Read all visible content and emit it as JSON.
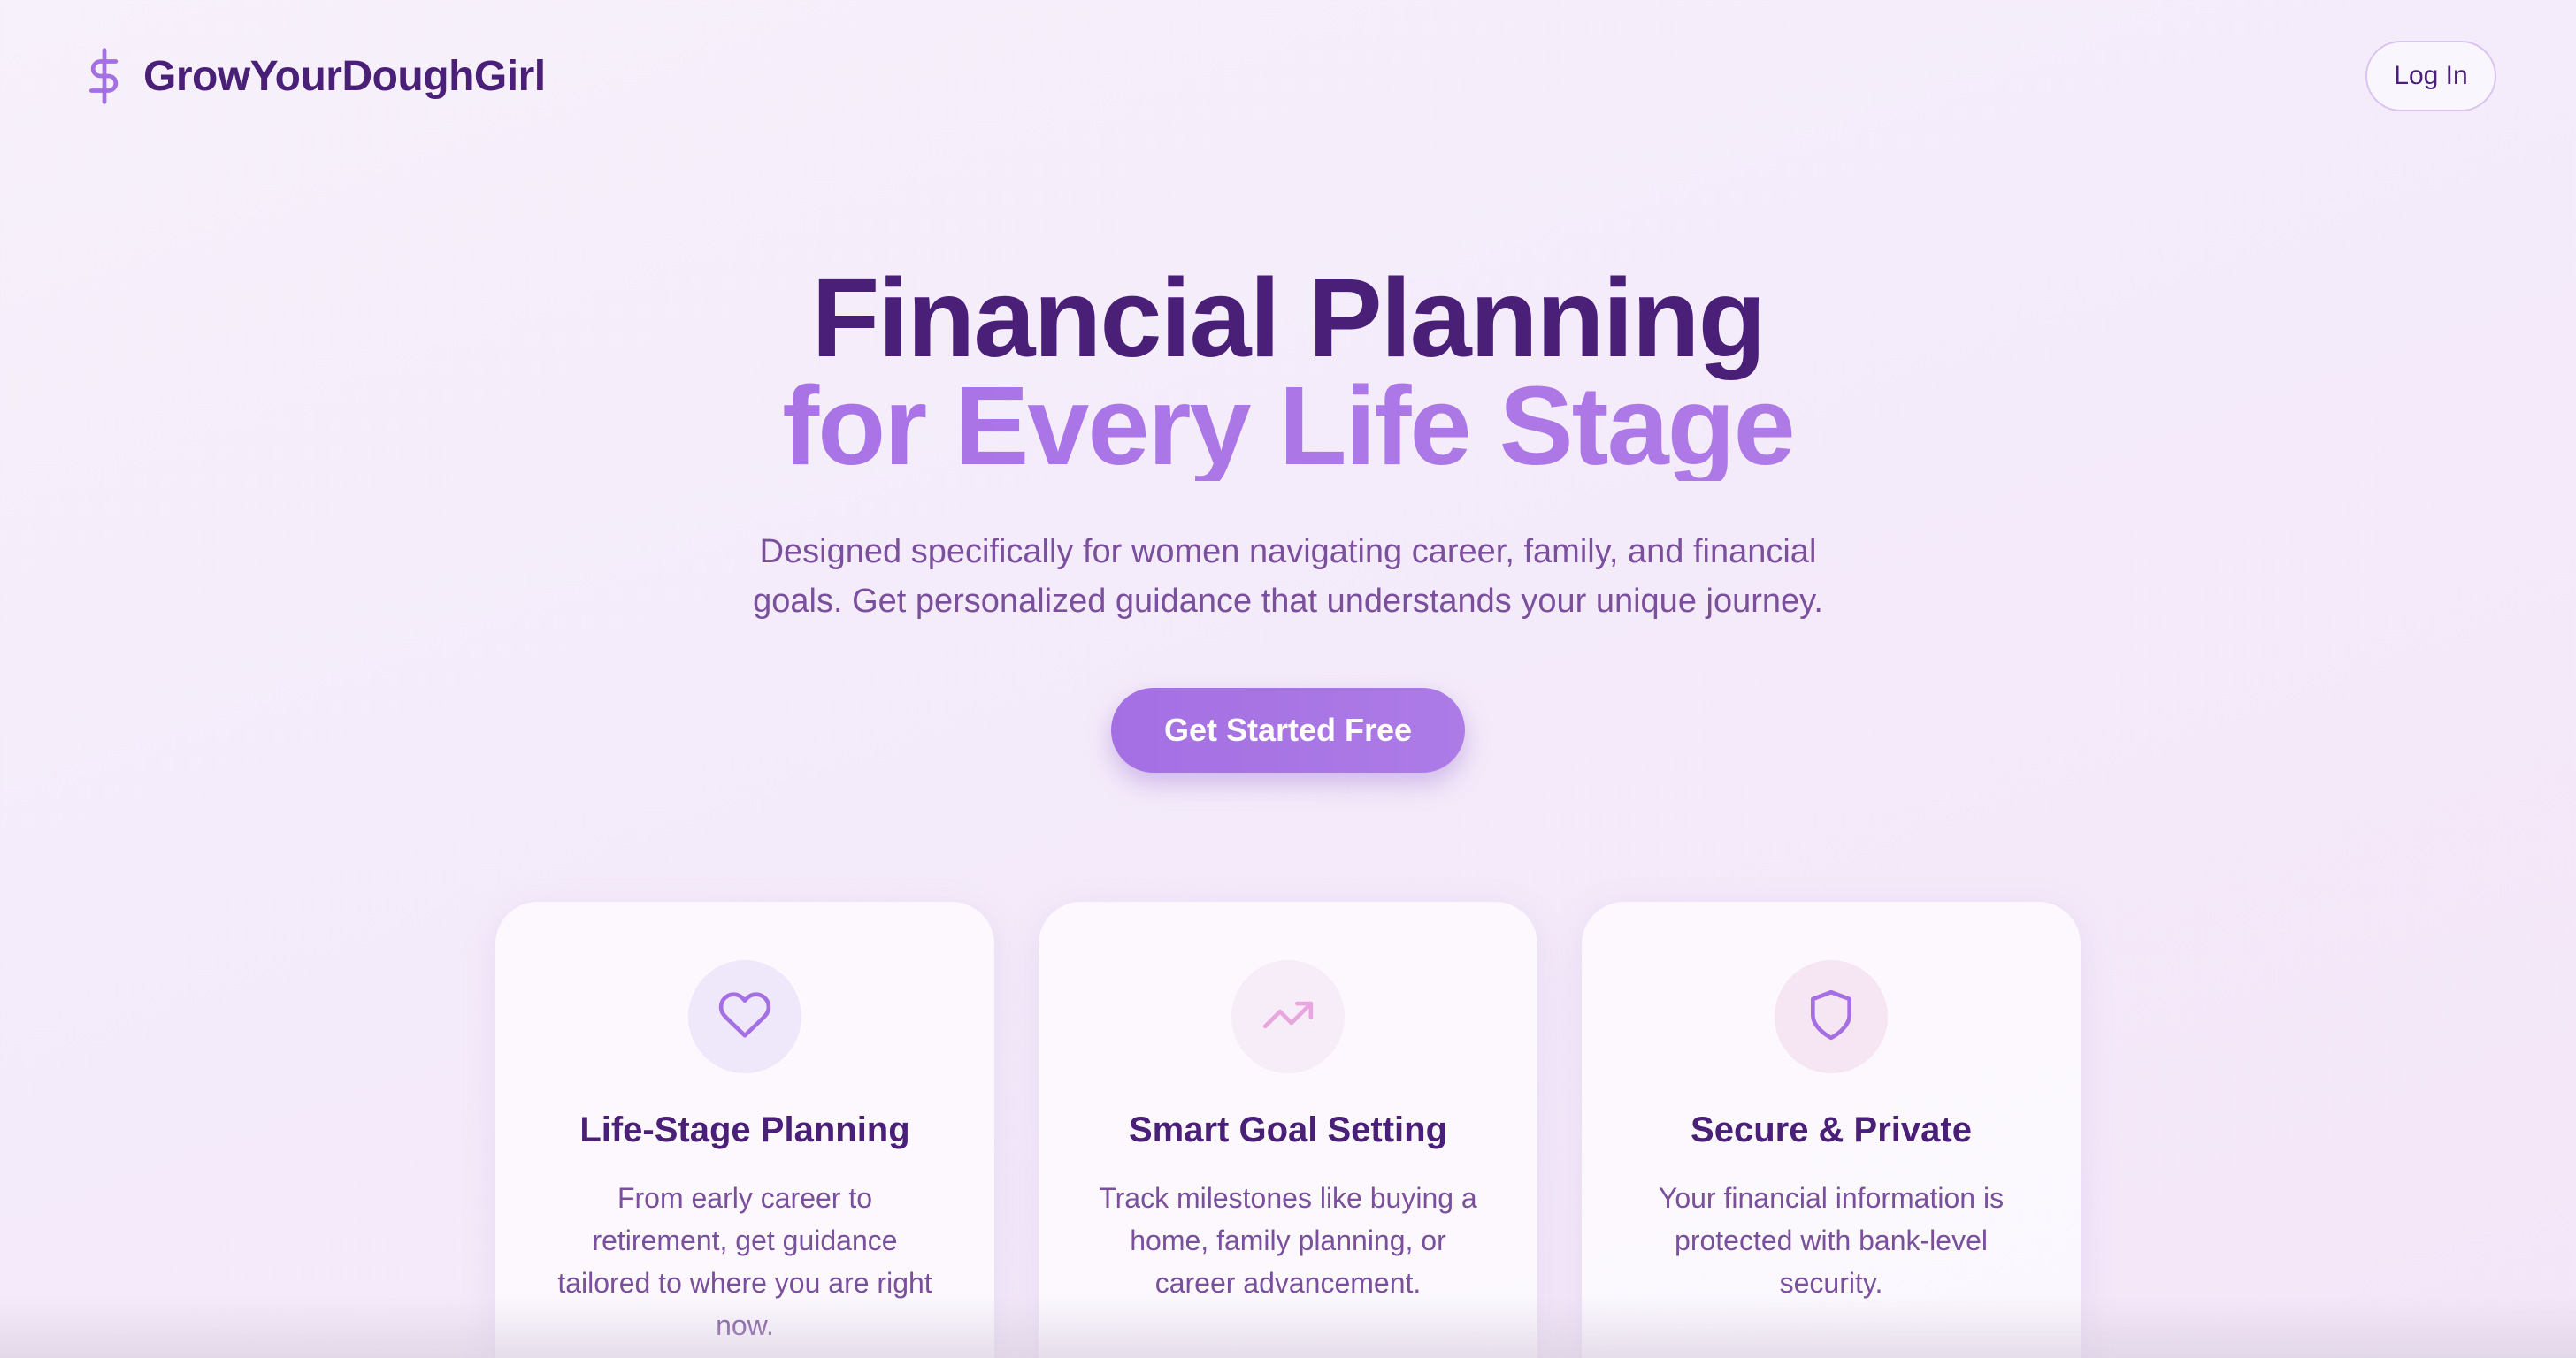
{
  "header": {
    "brand_name": "GrowYourDoughGirl",
    "brand_icon": "dollar-sign-icon",
    "login_label": "Log In"
  },
  "hero": {
    "title_line1": "Financial Planning",
    "title_line2": "for Every Life Stage",
    "subtitle": "Designed specifically for women navigating career, family, and financial goals. Get personalized guidance that understands your unique journey.",
    "cta_label": "Get Started Free"
  },
  "features": [
    {
      "icon": "heart-icon",
      "title": "Life-Stage Planning",
      "description": "From early career to retirement, get guidance tailored to where you are right now."
    },
    {
      "icon": "trending-up-icon",
      "title": "Smart Goal Setting",
      "description": "Track milestones like buying a home, family planning, or career advancement."
    },
    {
      "icon": "shield-icon",
      "title": "Secure & Private",
      "description": "Your financial information is protected with bank-level security."
    }
  ],
  "colors": {
    "primary_dark": "#4a1f78",
    "accent_purple": "#a46fe3",
    "body_text": "#7a4f9c",
    "icon_bg_lavender": "#efe6fa",
    "icon_bg_pink": "#f6eaf6"
  }
}
